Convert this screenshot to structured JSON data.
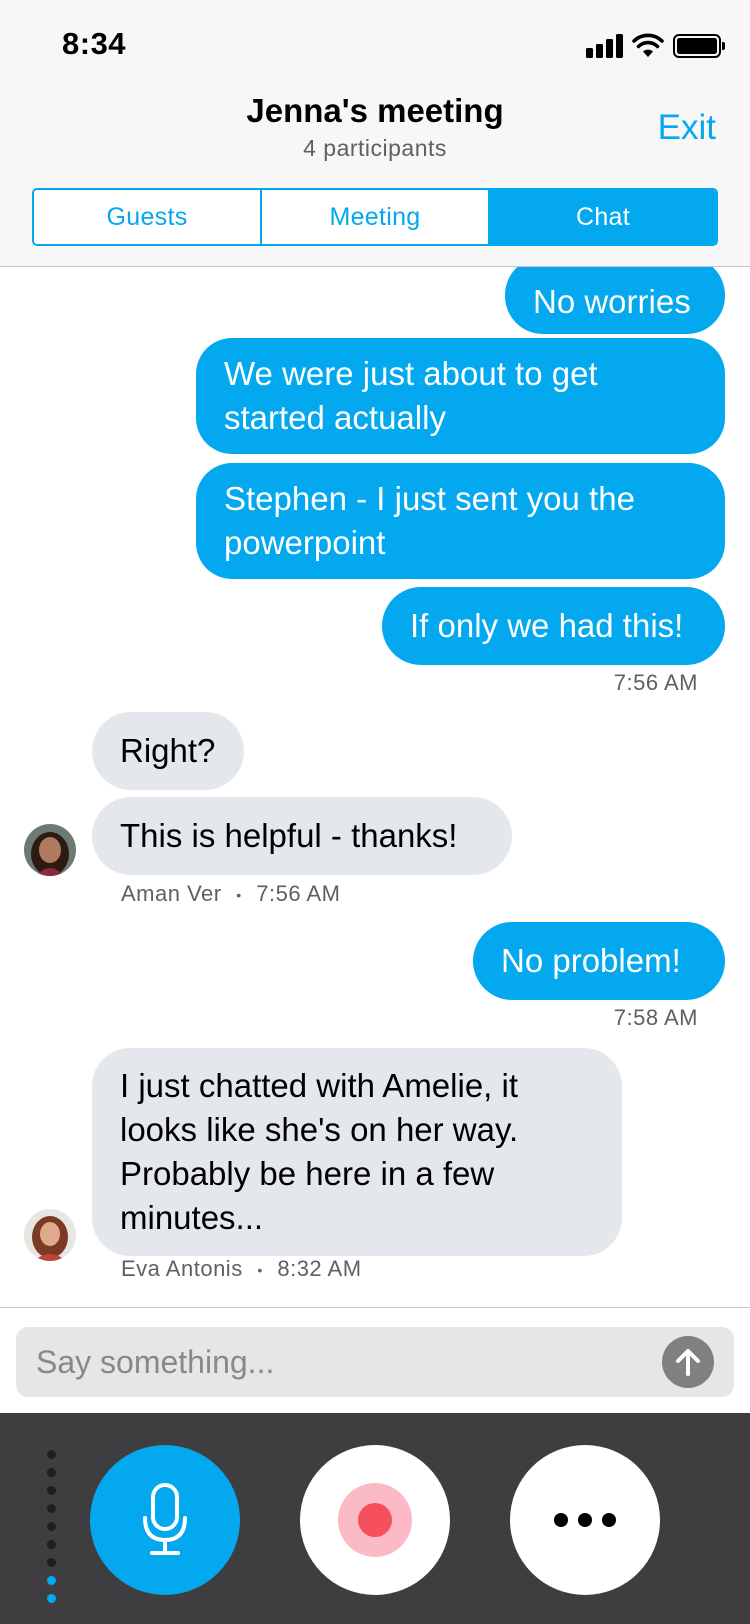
{
  "status_bar": {
    "time": "8:34"
  },
  "header": {
    "title": "Jenna's meeting",
    "subtitle": "4 participants",
    "exit_label": "Exit"
  },
  "tabs": [
    {
      "label": "Guests",
      "active": false
    },
    {
      "label": "Meeting",
      "active": false
    },
    {
      "label": "Chat",
      "active": true
    }
  ],
  "messages": [
    {
      "direction": "outgoing",
      "text": "No worries"
    },
    {
      "direction": "outgoing",
      "lines": [
        "We were just about to get",
        "started actually"
      ]
    },
    {
      "direction": "outgoing",
      "lines": [
        "Stephen - I just sent you the",
        "powerpoint"
      ]
    },
    {
      "direction": "outgoing",
      "text": "If only we had this!"
    },
    {
      "direction": "outgoing",
      "time": "7:56 AM"
    },
    {
      "direction": "incoming",
      "text": "Right?"
    },
    {
      "direction": "incoming",
      "text": "This is helpful - thanks!"
    },
    {
      "direction": "incoming",
      "sender": "Aman Ver",
      "separator": "•",
      "time": "7:56 AM"
    },
    {
      "direction": "outgoing",
      "text": "No problem!"
    },
    {
      "direction": "outgoing",
      "time": "7:58 AM"
    },
    {
      "direction": "incoming",
      "lines": [
        "I just chatted with Amelie, it",
        "looks like she's on her way.",
        "Probably be here in a few",
        "minutes..."
      ]
    },
    {
      "direction": "incoming",
      "sender": "Eva Antonis",
      "separator": "•",
      "time": "8:32 AM"
    }
  ],
  "composer": {
    "placeholder": "Say something..."
  },
  "colors": {
    "accent": "#03a8ee",
    "incoming_bubble": "#e4e8ed",
    "control_bar": "#3e3e40",
    "record": "#f6505c"
  },
  "icons": [
    "signal-icon",
    "wifi-icon",
    "battery-icon",
    "send-arrow-icon",
    "microphone-icon",
    "record-icon",
    "more-icon"
  ]
}
